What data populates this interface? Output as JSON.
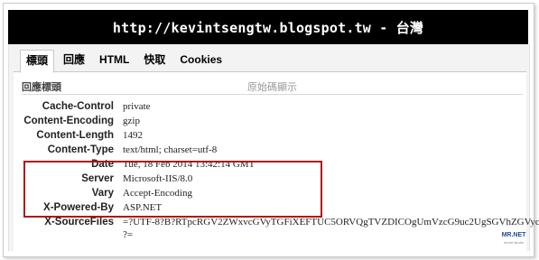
{
  "banner": {
    "title": "http://kevintsengtw.blogspot.tw - 台灣"
  },
  "tabs": [
    {
      "label": "標頭"
    },
    {
      "label": "回應"
    },
    {
      "label": "HTML"
    },
    {
      "label": "快取"
    },
    {
      "label": "Cookies"
    }
  ],
  "section": {
    "title": "回應標頭",
    "view_source": "原始碼顯示"
  },
  "headers": [
    {
      "name": "Cache-Control",
      "value": "private"
    },
    {
      "name": "Content-Encoding",
      "value": "gzip"
    },
    {
      "name": "Content-Length",
      "value": "1492"
    },
    {
      "name": "Content-Type",
      "value": "text/html; charset=utf-8"
    },
    {
      "name": "Date",
      "value": "Tue, 18 Feb 2014 13:42:14 GMT"
    },
    {
      "name": "Server",
      "value": "Microsoft-IIS/8.0"
    },
    {
      "name": "Vary",
      "value": "Accept-Encoding"
    },
    {
      "name": "X-Powered-By",
      "value": "ASP.NET"
    },
    {
      "name": "X-SourceFiles",
      "value": "=?UTF-8?B?RTpcRGV2ZWxvcGVyTGFiXEFTUC5ORVQgTVZDICOgUmVzcG9uc2UgSGVhZGVyc1xXZ",
      "value2": "?="
    }
  ],
  "logo": {
    "text": "MR.NET",
    "sub": "mrnet studio"
  }
}
